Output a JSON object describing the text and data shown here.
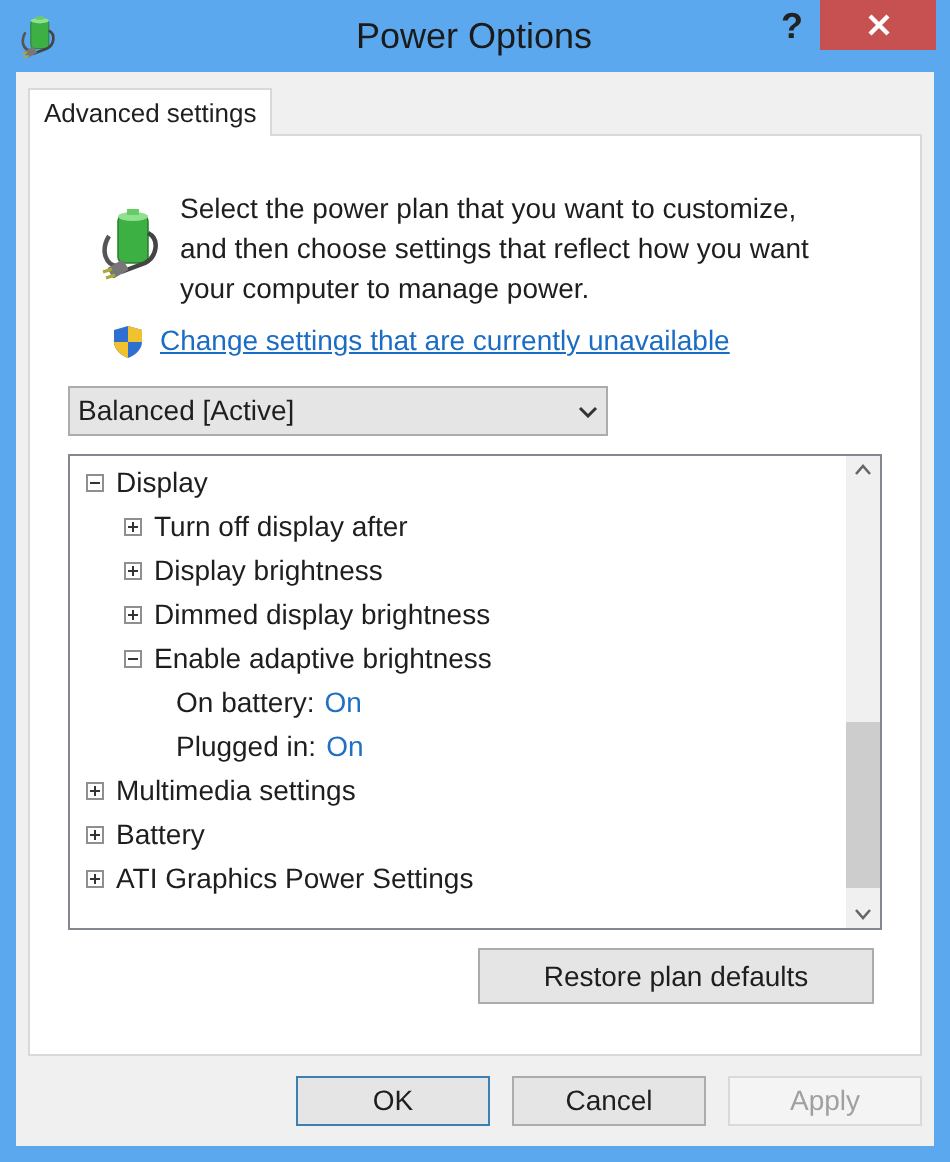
{
  "window": {
    "title": "Power Options",
    "help": "?"
  },
  "tabs": [
    {
      "label": "Advanced settings",
      "selected": true
    }
  ],
  "intro": "Select the power plan that you want to customize, and then choose settings that reflect how you want your computer to manage power.",
  "link": "Change settings that are currently unavailable",
  "plan": {
    "value": "Balanced [Active]"
  },
  "tree": [
    {
      "kind": "group",
      "label": "Display",
      "expanded": true,
      "children": [
        {
          "kind": "group",
          "label": "Turn off display after",
          "expanded": false
        },
        {
          "kind": "group",
          "label": "Display brightness",
          "expanded": false
        },
        {
          "kind": "group",
          "label": "Dimmed display brightness",
          "expanded": false
        },
        {
          "kind": "group",
          "label": "Enable adaptive brightness",
          "expanded": true,
          "children": [
            {
              "kind": "value",
              "label": "On battery:",
              "value": "On"
            },
            {
              "kind": "value",
              "label": "Plugged in:",
              "value": "On"
            }
          ]
        }
      ]
    },
    {
      "kind": "group",
      "label": "Multimedia settings",
      "expanded": false
    },
    {
      "kind": "group",
      "label": "Battery",
      "expanded": false
    },
    {
      "kind": "group",
      "label": "ATI Graphics Power Settings",
      "expanded": false
    }
  ],
  "restore_button": "Restore plan defaults",
  "buttons": [
    {
      "label": "OK",
      "default": true,
      "disabled": false
    },
    {
      "label": "Cancel",
      "default": false,
      "disabled": false
    },
    {
      "label": "Apply",
      "default": false,
      "disabled": true
    }
  ]
}
